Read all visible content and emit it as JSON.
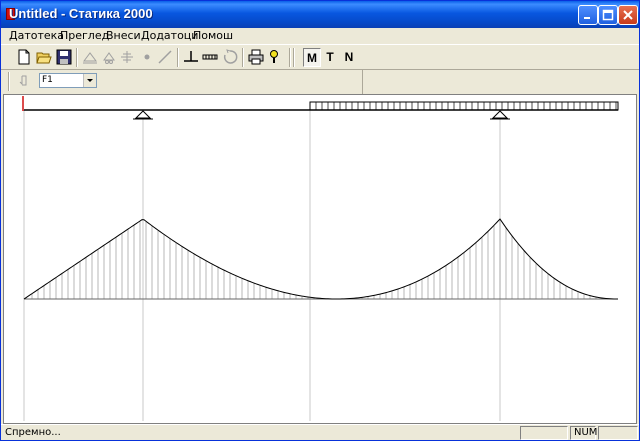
{
  "window": {
    "title": "Untitled - Статика 2000",
    "minimize_glyph": "_",
    "maximize_glyph": "□",
    "close_glyph": "×"
  },
  "menu": {
    "items": [
      "Датотека",
      "Преглед",
      "Внеси",
      "Додатоци",
      "Помош"
    ]
  },
  "toolbar": {
    "icons": [
      "new-icon",
      "open-icon",
      "save-icon",
      "fixed-support-icon",
      "pinned-support-icon",
      "roller-support-icon",
      "node-icon",
      "member-icon",
      "point-load-icon",
      "distributed-load-icon",
      "moment-icon",
      "print-icon",
      "help-icon"
    ],
    "diagram_buttons": [
      "M",
      "T",
      "N"
    ],
    "active_diagram": "M"
  },
  "toolbar2": {
    "cursor_icon": "pointer-icon",
    "load_case": "F1"
  },
  "status": {
    "text": "Спремно...",
    "num_indicator": "NUM"
  },
  "colors": {
    "titlebar": "#0857e0",
    "diagram_line": "#000000",
    "hatch": "#999999",
    "support_icon_red": "#d01010"
  }
}
